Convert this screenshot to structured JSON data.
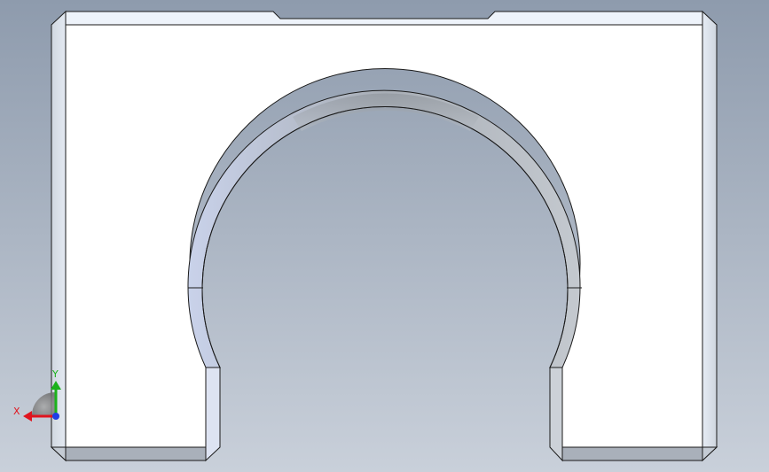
{
  "viewport": {
    "background": {
      "top": "#8e9bad",
      "bottom": "#c9d0da"
    }
  },
  "part": {
    "face_color": "#ffffff",
    "edge_color": "#1a1a1a",
    "chamfer_light": "#dfe6f0",
    "chamfer_dark": "#9aa3ae",
    "arch_inner_light": "#c9d2ea",
    "arch_inner_dark": "#8b9198"
  },
  "triad": {
    "x_label": "X",
    "y_label": "Y",
    "x_color": "#e0141e",
    "y_color": "#1bb21b",
    "z_color": "#1e3ee6"
  }
}
